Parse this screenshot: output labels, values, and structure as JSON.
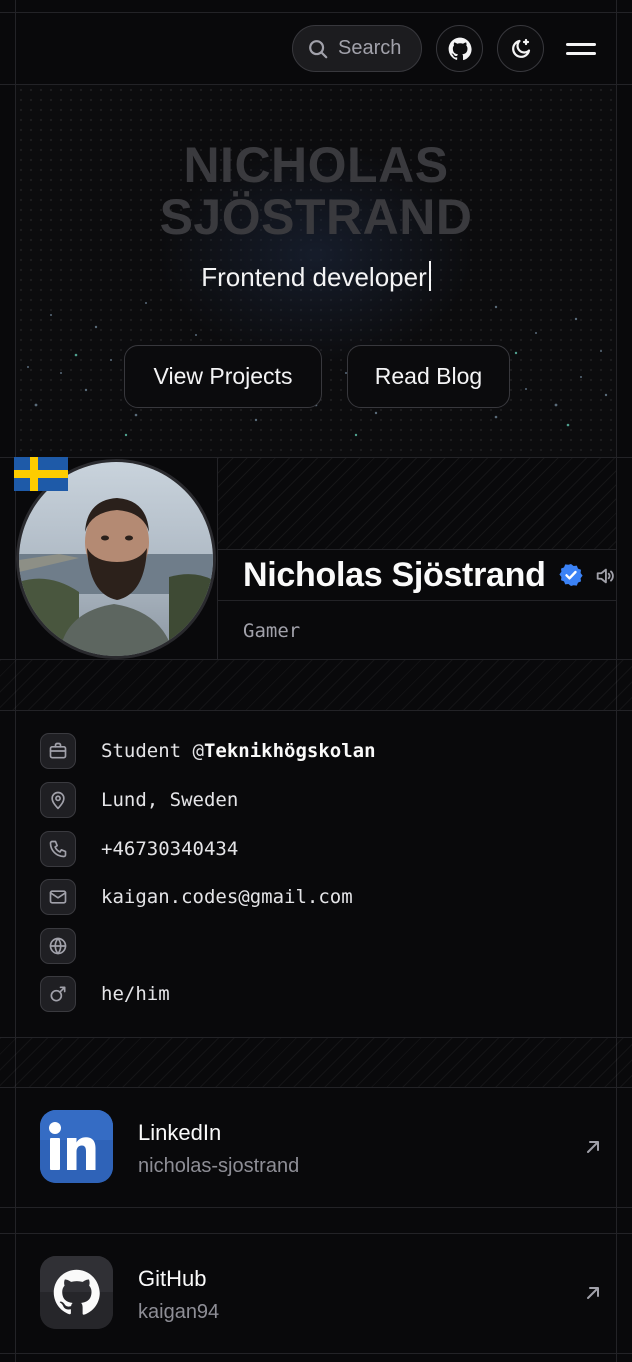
{
  "header": {
    "search_label": "Search",
    "icons": [
      "search-icon",
      "github-icon",
      "theme-toggle-icon",
      "menu-icon"
    ]
  },
  "hero": {
    "name_line1": "NICHOLAS",
    "name_line2": "SJÖSTRAND",
    "role": "Frontend developer",
    "view_projects": "View Projects",
    "read_blog": "Read Blog"
  },
  "profile": {
    "name": "Nicholas Sjöstrand",
    "tagline": "Gamer",
    "verified": true,
    "flag": "sweden"
  },
  "info": {
    "job_prefix": "Student @",
    "job_company": "Teknikhögskolan",
    "location": "Lund, Sweden",
    "phone": "+46730340434",
    "email": "kaigan.codes@gmail.com",
    "website": "",
    "pronouns": "he/him"
  },
  "social": [
    {
      "name": "LinkedIn",
      "handle": "nicholas-sjostrand",
      "icon": "linkedin-icon",
      "color": "#2f63b8"
    },
    {
      "name": "GitHub",
      "handle": "kaigan94",
      "icon": "github-icon",
      "color": "#26262a"
    }
  ],
  "colors": {
    "background": "#09090b",
    "verified_badge": "#3b82f6",
    "flag_blue": "#1e5aa8",
    "flag_yellow": "#fecc00"
  }
}
